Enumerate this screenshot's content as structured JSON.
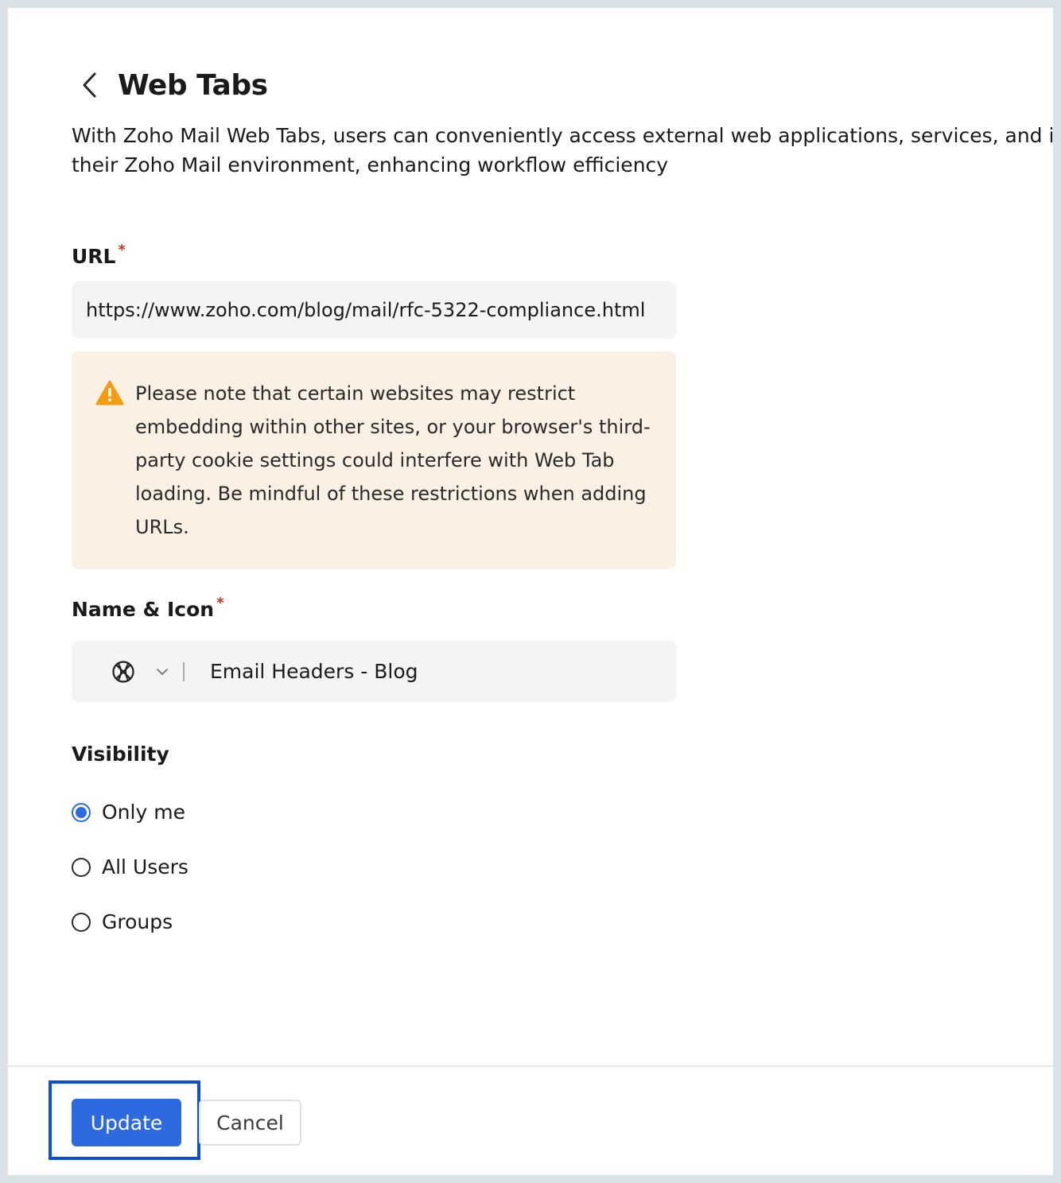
{
  "header": {
    "back_icon": "chevron-left-icon",
    "title": "Web Tabs"
  },
  "description": {
    "line1": "With Zoho Mail Web Tabs, users can conveniently access external web applications, services, and interna",
    "line2": "their Zoho Mail environment, enhancing workflow efficiency"
  },
  "url_field": {
    "label": "URL",
    "required_mark": "*",
    "value": "https://www.zoho.com/blog/mail/rfc-5322-compliance.html"
  },
  "warning": {
    "icon": "warning-triangle-icon",
    "text": "Please note that certain websites may restrict embedding within other sites, or your browser's third-party cookie settings could interfere with Web Tab loading. Be mindful of these restrictions when adding URLs.",
    "color": "#f39c12",
    "background": "#faf0e4"
  },
  "name_field": {
    "label": "Name & Icon",
    "required_mark": "*",
    "icon": "globe-icon",
    "dropdown_icon": "chevron-down-icon",
    "separator": "|",
    "value": "Email Headers - Blog"
  },
  "visibility": {
    "label": "Visibility",
    "options": [
      {
        "label": "Only me",
        "checked": true
      },
      {
        "label": "All Users",
        "checked": false
      },
      {
        "label": "Groups",
        "checked": false
      }
    ]
  },
  "footer": {
    "update_label": "Update",
    "cancel_label": "Cancel"
  },
  "colors": {
    "accent": "#2d6ae0",
    "highlight": "#0a4fd6",
    "required": "#c0392b"
  }
}
